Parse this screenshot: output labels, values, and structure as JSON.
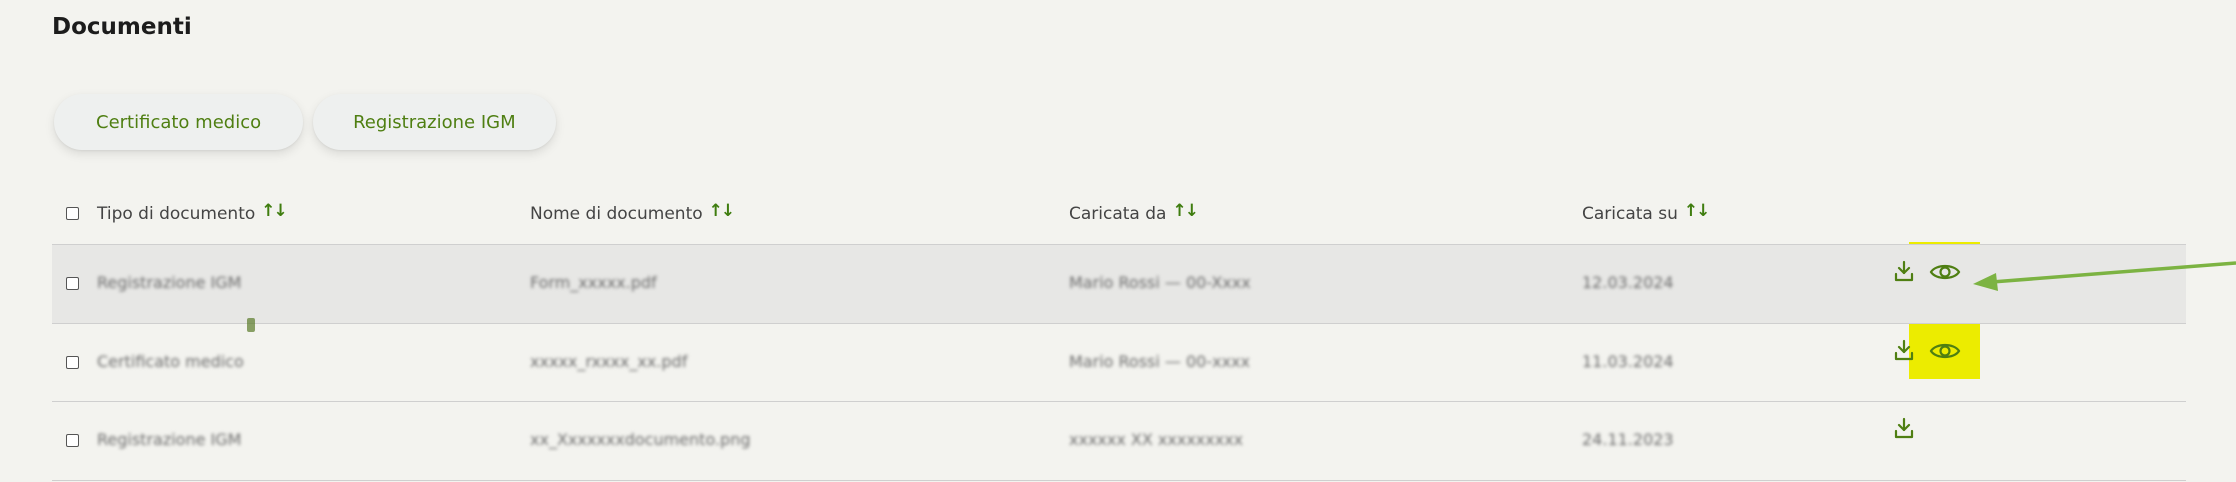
{
  "page": {
    "title": "Documenti"
  },
  "tabs": [
    {
      "label": "Certificato medico"
    },
    {
      "label": "Registrazione IGM"
    }
  ],
  "table": {
    "headers": [
      {
        "label": "Tipo di documento",
        "sort_icon": "sort-arrows-icon"
      },
      {
        "label": "Nome di documento",
        "sort_icon": "sort-arrows-icon"
      },
      {
        "label": "Caricata da",
        "sort_icon": "sort-arrows-icon"
      },
      {
        "label": "Caricata su",
        "sort_icon": "sort-arrows-icon"
      }
    ],
    "rows": [
      {
        "tipo": "Registrazione IGM",
        "nome": "Form_xxxxx.pdf",
        "caricata_da": "Mario Rossi — 00-Xxxx",
        "caricata_su": "12.03.2024",
        "actions": [
          "download-icon",
          "eye-icon"
        ]
      },
      {
        "tipo": "Certificato medico",
        "nome": "xxxxx_rxxxx_xx.pdf",
        "caricata_da": "Mario Rossi — 00-xxxx",
        "caricata_su": "11.03.2024",
        "actions": [
          "download-icon",
          "eye-icon"
        ]
      },
      {
        "tipo": "Registrazione IGM",
        "nome": "xx_Xxxxxxxdocumento.png",
        "caricata_da": "xxxxxx XX xxxxxxxxx",
        "caricata_su": "24.11.2023",
        "actions": [
          "download-icon"
        ]
      }
    ]
  },
  "colors": {
    "accent": "#4f7f12",
    "highlight": "#ecec00",
    "arrow": "#7cb342"
  }
}
